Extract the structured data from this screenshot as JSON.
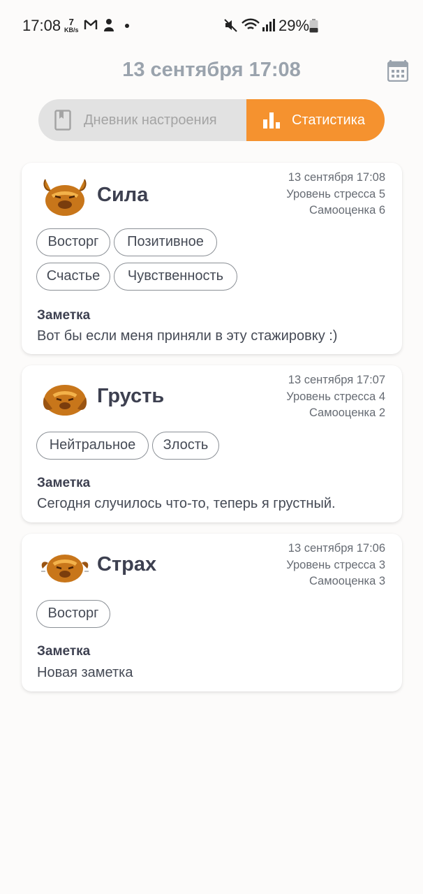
{
  "status_bar": {
    "time": "17:08",
    "speed_value": "7",
    "speed_unit": "KB/s",
    "battery": "29%",
    "icons": [
      "gmail-icon",
      "app-notification-icon",
      "dot-icon",
      "mute-icon",
      "wifi-icon",
      "signal-icon",
      "battery-icon"
    ]
  },
  "header": {
    "date": "13 сентября 17:08",
    "calendar_icon": "calendar-icon"
  },
  "tabs": {
    "diary": "Дневник настроения",
    "stats": "Статистика",
    "active": "stats",
    "active_color": "#f5922f"
  },
  "entries": [
    {
      "mood": "Сила",
      "date": "13 сентября 17:08",
      "stress": "Уровень стресса 5",
      "self_esteem": "Самооценка 6",
      "tags": [
        "Восторг",
        "Позитивное",
        "Счастье",
        "Чувственность"
      ],
      "note_title": "Заметка",
      "note": "Вот бы если меня приняли в эту стажировку :)"
    },
    {
      "mood": "Грусть",
      "date": "13 сентября 17:07",
      "stress": "Уровень стресса 4",
      "self_esteem": "Самооценка 2",
      "tags": [
        "Нейтральное",
        "Злость"
      ],
      "note_title": "Заметка",
      "note": "Сегодня случилось что-то, теперь я грустный."
    },
    {
      "mood": "Страх",
      "date": "13 сентября 17:06",
      "stress": "Уровень стресса 3",
      "self_esteem": "Самооценка 3",
      "tags": [
        "Восторг"
      ],
      "note_title": "Заметка",
      "note": "Новая заметка"
    }
  ]
}
